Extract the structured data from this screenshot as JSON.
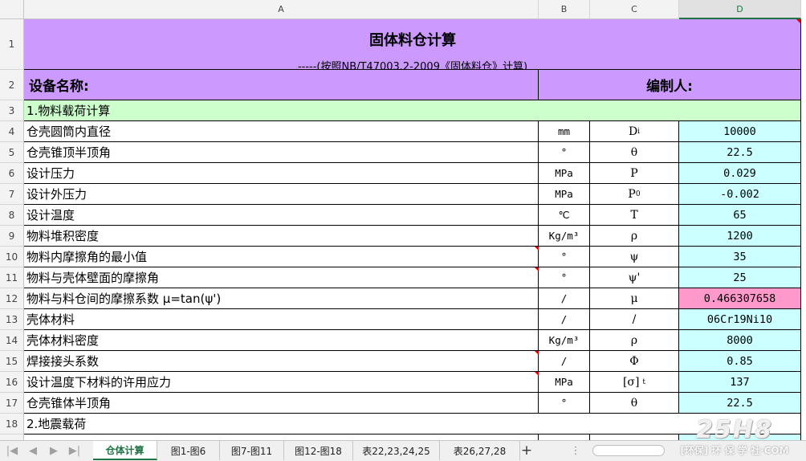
{
  "columns": [
    "A",
    "B",
    "C",
    "D"
  ],
  "selected_column": "D",
  "title": "固体料仓计算",
  "subtitle": "-----(按照NB/T47003.2-2009《固体料仓》计算)",
  "row2": {
    "left": "设备名称:",
    "right": "编制人:"
  },
  "section1": "1.物料载荷计算",
  "rows": [
    {
      "num": "4",
      "label": "仓壳圆筒内直径",
      "unit": "mm",
      "sym_main": "D",
      "sym_sub": "i",
      "sym_sup": "",
      "value": "10000",
      "highlight": false,
      "comment": false
    },
    {
      "num": "5",
      "label": "仓壳锥顶半顶角",
      "unit": "°",
      "sym_main": "θ",
      "sym_sub": "",
      "sym_sup": "",
      "value": "22.5",
      "highlight": false,
      "comment": false
    },
    {
      "num": "6",
      "label": "设计压力",
      "unit": "MPa",
      "sym_main": "P",
      "sym_sub": "",
      "sym_sup": "",
      "value": "0.029",
      "highlight": false,
      "comment": false
    },
    {
      "num": "7",
      "label": "设计外压力",
      "unit": "MPa",
      "sym_main": "P",
      "sym_sub": "0",
      "sym_sup": "",
      "value": "-0.002",
      "highlight": false,
      "comment": false
    },
    {
      "num": "8",
      "label": "设计温度",
      "unit": "℃",
      "sym_main": "T",
      "sym_sub": "",
      "sym_sup": "",
      "value": "65",
      "highlight": false,
      "comment": false
    },
    {
      "num": "9",
      "label": "物料堆积密度",
      "unit": "Kg/m³",
      "sym_main": "ρ",
      "sym_sub": "",
      "sym_sup": "",
      "value": "1200",
      "highlight": false,
      "comment": false
    },
    {
      "num": "10",
      "label": "物料内摩擦角的最小值",
      "unit": "°",
      "sym_main": "ψ",
      "sym_sub": "",
      "sym_sup": "",
      "value": "35",
      "highlight": false,
      "comment": true
    },
    {
      "num": "11",
      "label": "物料与壳体壁面的摩擦角",
      "unit": "°",
      "sym_main": "ψ'",
      "sym_sub": "",
      "sym_sup": "",
      "value": "25",
      "highlight": false,
      "comment": true
    },
    {
      "num": "12",
      "label": "物料与料仓间的摩擦系数      μ=tan(ψ')",
      "unit": "/",
      "sym_main": "μ",
      "sym_sub": "",
      "sym_sup": "",
      "value": "0.466307658",
      "highlight": true,
      "comment": false
    },
    {
      "num": "13",
      "label": "壳体材料",
      "unit": "/",
      "sym_main": "/",
      "sym_sub": "",
      "sym_sup": "",
      "value": "06Cr19Ni10",
      "highlight": false,
      "comment": false
    },
    {
      "num": "14",
      "label": "壳体材料密度",
      "unit": "Kg/m³",
      "sym_main": "ρ",
      "sym_sub": "",
      "sym_sup": "",
      "value": "8000",
      "highlight": false,
      "comment": false
    },
    {
      "num": "15",
      "label": "焊接接头系数",
      "unit": "/",
      "sym_main": "Φ",
      "sym_sub": "",
      "sym_sup": "",
      "value": "0.85",
      "highlight": false,
      "comment": true
    },
    {
      "num": "16",
      "label": "设计温度下材料的许用应力",
      "unit": "MPa",
      "sym_main": "[σ]",
      "sym_sub": "",
      "sym_sup": "t",
      "value": "137",
      "highlight": false,
      "comment": true
    },
    {
      "num": "17",
      "label": "仓壳锥体半顶角",
      "unit": "°",
      "sym_main": "θ",
      "sym_sub": "",
      "sym_sup": "",
      "value": "22.5",
      "highlight": false,
      "comment": false
    }
  ],
  "section2": "2.地震载荷",
  "row_numbers": {
    "r1": "1",
    "r2": "2",
    "r3": "3",
    "r18": "18"
  },
  "sheet_tabs": [
    "仓体计算",
    "图1-图6",
    "图7-图11",
    "图12-图18",
    "表22,23,24,25",
    "表26,27,28"
  ],
  "active_tab": 0,
  "add_sheet": "+",
  "watermark": {
    "big": "25H8",
    "small": "[环保] 环 保 学 社·COM"
  },
  "colors": {
    "title_bg": "#cc99ff",
    "section_bg": "#ccffcc",
    "input_bg": "#ccffff",
    "result_bg": "#ff99cc",
    "accent": "#217346"
  }
}
